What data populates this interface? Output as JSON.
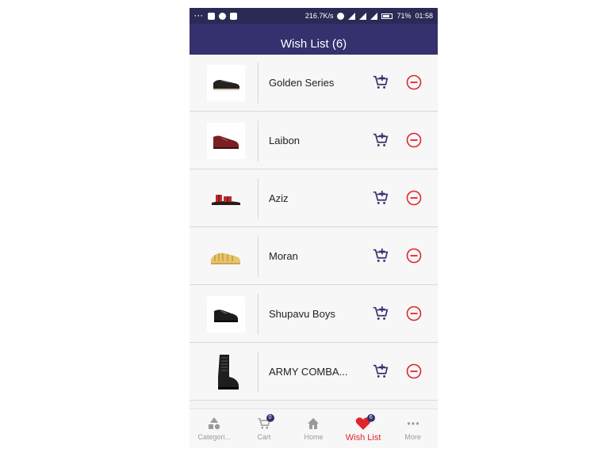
{
  "status_bar": {
    "speed": "216.7K/s",
    "battery": "71%",
    "time": "01:58"
  },
  "header": {
    "title": "Wish List (6)"
  },
  "items": [
    {
      "name": "Golden Series",
      "image": "sneaker-black"
    },
    {
      "name": "Laibon",
      "image": "oxford-maroon"
    },
    {
      "name": "Aziz",
      "image": "sandal-red"
    },
    {
      "name": "Moran",
      "image": "jelly-sandal-yellow"
    },
    {
      "name": "Shupavu Boys",
      "image": "school-shoe-black"
    },
    {
      "name": "ARMY COMBA...",
      "image": "combat-boot-black"
    }
  ],
  "bottom_nav": [
    {
      "label": "Categori...",
      "icon": "categories-icon"
    },
    {
      "label": "Cart",
      "icon": "cart-icon",
      "badge": "0"
    },
    {
      "label": "Home",
      "icon": "home-icon"
    },
    {
      "label": "Wish List",
      "icon": "heart-icon",
      "badge": "6",
      "active": true
    },
    {
      "label": "More",
      "icon": "more-icon"
    }
  ],
  "colors": {
    "primary": "#35306e",
    "status_bar": "#2b2a55",
    "remove": "#e0262c",
    "active": "#e0262c"
  }
}
